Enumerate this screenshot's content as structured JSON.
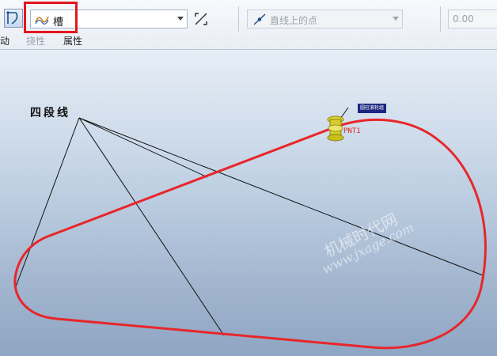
{
  "toolbar": {
    "profile_combo": {
      "value": "槽"
    },
    "reference_combo": {
      "value": "直线上的点"
    },
    "value_field": {
      "value": "0.00"
    },
    "tabs": [
      "动",
      "挠性",
      "属性"
    ]
  },
  "canvas": {
    "sketch_label": "四段线",
    "component_tag": "圆柱滚轮组",
    "point_label": "PNT1",
    "watermark_line1": "机械时代网",
    "watermark_line2": "www.jxage.com"
  },
  "colors": {
    "highlight": "#e2171f",
    "profile_curve": "#e8262a",
    "background_top": "#e7eef6",
    "background_bottom": "#8ea5c3"
  },
  "icons": [
    "sketch-tool-icon",
    "slot-profile-icon",
    "flip-direction-icon",
    "point-on-line-icon"
  ]
}
